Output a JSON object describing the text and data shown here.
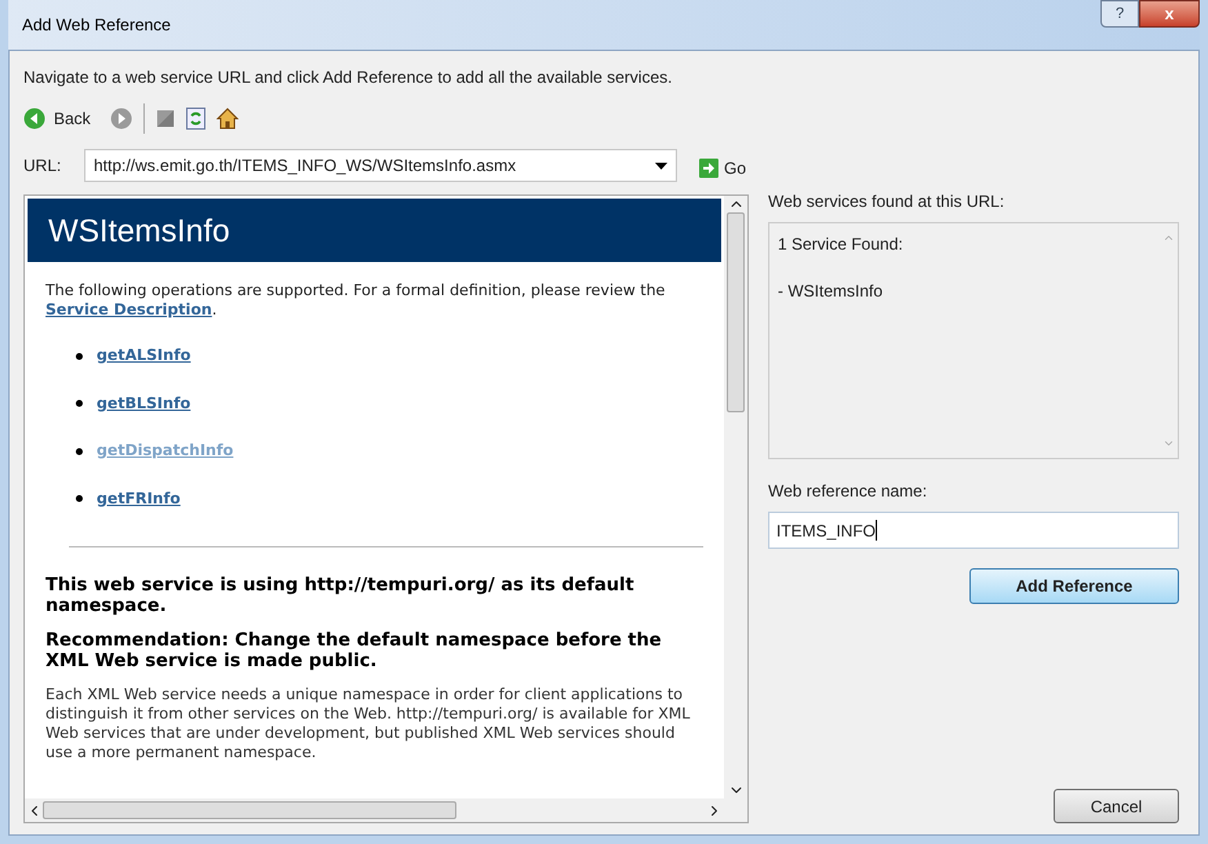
{
  "window": {
    "title": "Add Web Reference",
    "help_button": "?",
    "close_button": "x"
  },
  "instructions": "Navigate to a web service URL and click Add Reference to add all the available services.",
  "toolbar": {
    "back_label": "Back"
  },
  "url": {
    "label": "URL:",
    "value": "http://ws.emit.go.th/ITEMS_INFO_WS/WSItemsInfo.asmx",
    "go_label": "Go"
  },
  "browser": {
    "heading": "WSItemsInfo",
    "intro_before": "The following operations are supported. For a formal definition, please review the ",
    "intro_link": "Service Description",
    "intro_after": ".",
    "operations": [
      {
        "label": "getALSInfo",
        "visited": false
      },
      {
        "label": "getBLSInfo",
        "visited": false
      },
      {
        "label": "getDispatchInfo",
        "visited": true
      },
      {
        "label": "getFRInfo",
        "visited": false
      }
    ],
    "notice": "This web service is using http://tempuri.org/ as its default namespace.",
    "recommendation": "Recommendation: Change the default namespace before the XML Web service is made public.",
    "body": "Each XML Web service needs a unique namespace in order for client applications to distinguish it from other services on the Web. http://tempuri.org/ is available for XML Web services that are under development, but published XML Web services should use a more permanent namespace."
  },
  "services": {
    "label": "Web services found at this URL:",
    "lines": [
      "1 Service Found:",
      "- WSItemsInfo"
    ]
  },
  "reference_name": {
    "label": "Web reference name:",
    "value": "ITEMS_INFO"
  },
  "buttons": {
    "add": "Add Reference",
    "cancel": "Cancel"
  }
}
